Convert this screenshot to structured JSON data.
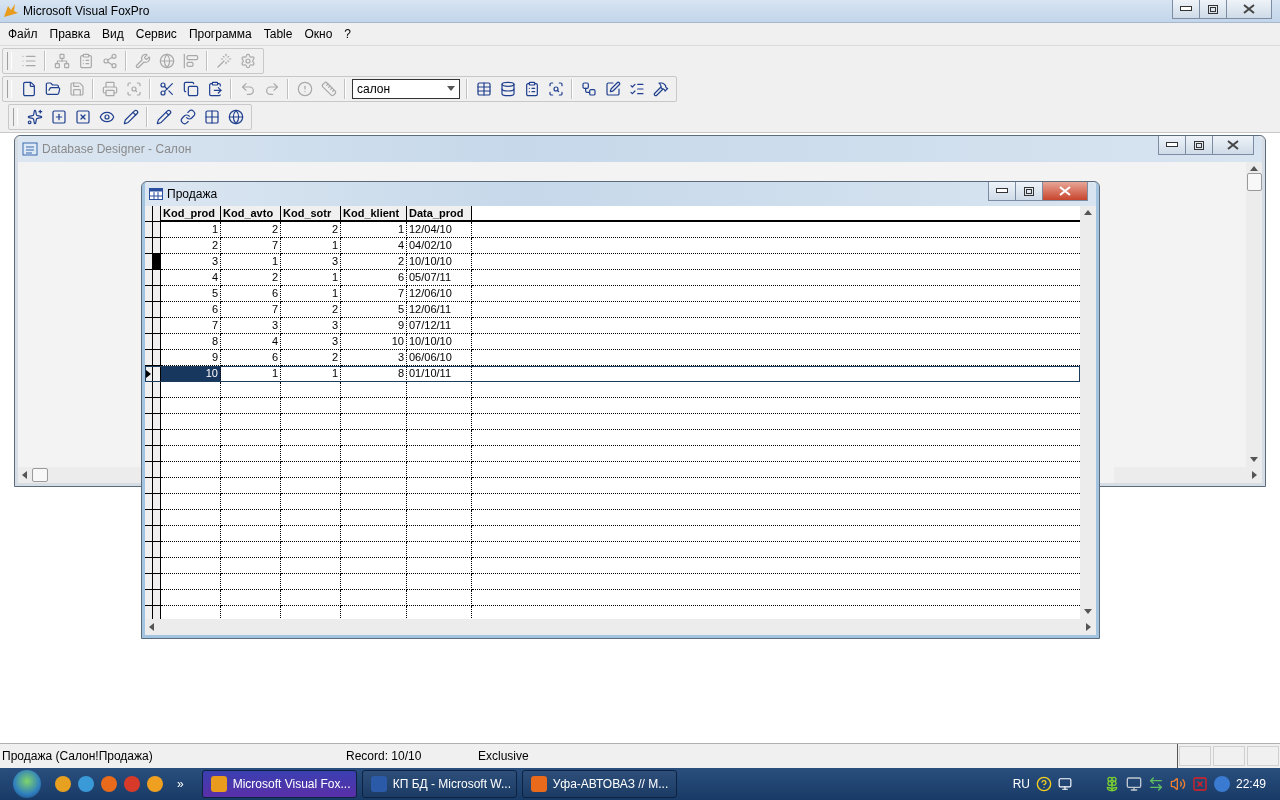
{
  "window": {
    "title": "Microsoft Visual FoxPro"
  },
  "menu": [
    "Файл",
    "Правка",
    "Вид",
    "Сервис",
    "Программа",
    "Table",
    "Окно",
    "?"
  ],
  "toolbars": [
    {
      "items": [
        {
          "kind": "button",
          "disabled": true
        },
        {
          "kind": "separator"
        },
        {
          "kind": "button",
          "disabled": true
        },
        {
          "kind": "button",
          "disabled": true
        },
        {
          "kind": "button",
          "disabled": true
        },
        {
          "kind": "separator"
        },
        {
          "kind": "button",
          "disabled": true
        },
        {
          "kind": "button",
          "disabled": true
        },
        {
          "kind": "button",
          "disabled": true
        },
        {
          "kind": "separator"
        },
        {
          "kind": "button",
          "disabled": true
        },
        {
          "kind": "button",
          "disabled": true
        }
      ]
    },
    {
      "items": [
        {
          "kind": "button",
          "disabled": false
        },
        {
          "kind": "button",
          "disabled": false
        },
        {
          "kind": "button",
          "disabled": true
        },
        {
          "kind": "separator"
        },
        {
          "kind": "button",
          "disabled": true
        },
        {
          "kind": "button",
          "disabled": true
        },
        {
          "kind": "separator"
        },
        {
          "kind": "button",
          "disabled": false
        },
        {
          "kind": "button",
          "disabled": false
        },
        {
          "kind": "button",
          "disabled": false
        },
        {
          "kind": "separator"
        },
        {
          "kind": "button",
          "disabled": true
        },
        {
          "kind": "button",
          "disabled": true
        },
        {
          "kind": "separator"
        },
        {
          "kind": "button",
          "disabled": true
        },
        {
          "kind": "button",
          "disabled": true
        },
        {
          "kind": "separator"
        },
        {
          "kind": "combo",
          "value": "салон"
        },
        {
          "kind": "separator"
        },
        {
          "kind": "button",
          "disabled": false
        },
        {
          "kind": "button",
          "disabled": false
        },
        {
          "kind": "button",
          "disabled": false
        },
        {
          "kind": "button",
          "disabled": false
        },
        {
          "kind": "separator"
        },
        {
          "kind": "button",
          "disabled": false
        },
        {
          "kind": "button",
          "disabled": false
        },
        {
          "kind": "button",
          "disabled": false
        },
        {
          "kind": "button",
          "disabled": false
        }
      ]
    },
    {
      "items": [
        {
          "kind": "button",
          "disabled": false
        },
        {
          "kind": "button",
          "disabled": false
        },
        {
          "kind": "button",
          "disabled": false
        },
        {
          "kind": "button",
          "disabled": false
        },
        {
          "kind": "button",
          "disabled": false
        },
        {
          "kind": "separator"
        },
        {
          "kind": "button",
          "disabled": false
        },
        {
          "kind": "button",
          "disabled": false
        },
        {
          "kind": "button",
          "disabled": false
        },
        {
          "kind": "button",
          "disabled": false
        }
      ]
    }
  ],
  "designer": {
    "title": "Database Designer - Салон",
    "active": false
  },
  "browse": {
    "title": "Продажа",
    "active": true,
    "columns": [
      {
        "label": "Kod_prod",
        "kind": "number"
      },
      {
        "label": "Kod_avto",
        "kind": "number"
      },
      {
        "label": "Kod_sotr",
        "kind": "number"
      },
      {
        "label": "Kod_klient",
        "kind": "number"
      },
      {
        "label": "Data_prod",
        "kind": "date"
      }
    ],
    "rows": [
      {
        "cells": [
          "1",
          "2",
          "2",
          "1",
          "12/04/10"
        ],
        "selected": false,
        "deleted": false
      },
      {
        "cells": [
          "2",
          "7",
          "1",
          "4",
          "04/02/10"
        ],
        "selected": false,
        "deleted": false
      },
      {
        "cells": [
          "3",
          "1",
          "3",
          "2",
          "10/10/10"
        ],
        "selected": false,
        "deleted": true
      },
      {
        "cells": [
          "4",
          "2",
          "1",
          "6",
          "05/07/11"
        ],
        "selected": false,
        "deleted": false
      },
      {
        "cells": [
          "5",
          "6",
          "1",
          "7",
          "12/06/10"
        ],
        "selected": false,
        "deleted": false
      },
      {
        "cells": [
          "6",
          "7",
          "2",
          "5",
          "12/06/11"
        ],
        "selected": false,
        "deleted": false
      },
      {
        "cells": [
          "7",
          "3",
          "3",
          "9",
          "07/12/11"
        ],
        "selected": false,
        "deleted": false
      },
      {
        "cells": [
          "8",
          "4",
          "3",
          "10",
          "10/10/10"
        ],
        "selected": false,
        "deleted": false
      },
      {
        "cells": [
          "9",
          "6",
          "2",
          "3",
          "06/06/10"
        ],
        "selected": false,
        "deleted": false
      },
      {
        "cells": [
          "10",
          "1",
          "1",
          "8",
          "01/10/11"
        ],
        "selected": true,
        "deleted": false
      }
    ]
  },
  "status_bar": {
    "message": "Продажа (Салон!Продажа)",
    "record": "Record: 10/10",
    "mode": "Exclusive"
  },
  "taskbar": {
    "more": "»",
    "tasks": [
      {
        "label": "Microsoft Visual Fox...",
        "selected": true
      },
      {
        "label": "КП БД - Microsoft W...",
        "selected": false
      },
      {
        "label": "Уфа-АВТОВАЗ // М...",
        "selected": false
      }
    ],
    "language": "RU",
    "time": "22:49"
  }
}
